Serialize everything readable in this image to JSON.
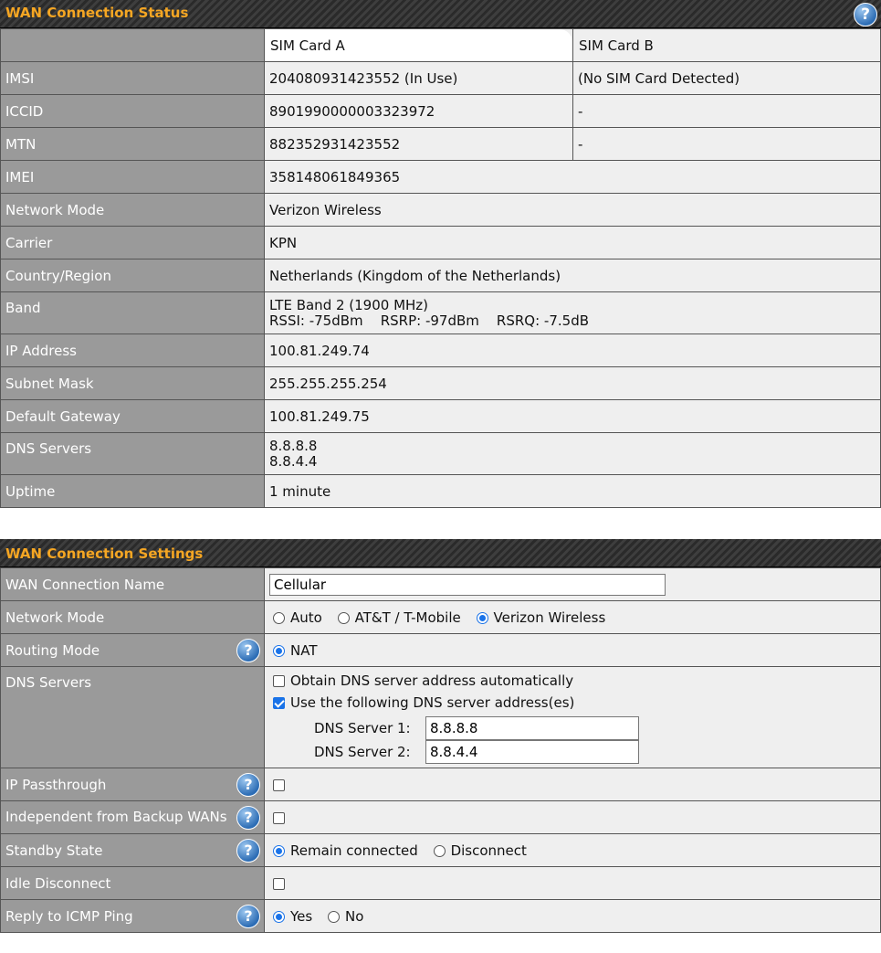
{
  "status": {
    "title": "WAN Connection Status",
    "columns": [
      "SIM Card A",
      "SIM Card B"
    ],
    "rows": [
      {
        "label": "IMSI",
        "a": "204080931423552 (In Use)",
        "b": "(No SIM Card Detected)"
      },
      {
        "label": "ICCID",
        "a": "8901990000003323972",
        "b": "-"
      },
      {
        "label": "MTN",
        "a": "882352931423552",
        "b": "-"
      },
      {
        "label": "IMEI",
        "value": "358148061849365"
      },
      {
        "label": "Network Mode",
        "value": "Verizon Wireless"
      },
      {
        "label": "Carrier",
        "value": "KPN"
      },
      {
        "label": "Country/Region",
        "value": "Netherlands (Kingdom of the Netherlands)"
      },
      {
        "label": "Band",
        "line1": "LTE Band 2 (1900 MHz)",
        "line2": "RSSI: -75dBm    RSRP: -97dBm    RSRQ: -7.5dB"
      },
      {
        "label": "IP Address",
        "value": "100.81.249.74"
      },
      {
        "label": "Subnet Mask",
        "value": "255.255.255.254"
      },
      {
        "label": "Default Gateway",
        "value": "100.81.249.75"
      },
      {
        "label": "DNS Servers",
        "line1": "8.8.8.8",
        "line2": "8.8.4.4"
      },
      {
        "label": "Uptime",
        "value": "1 minute"
      }
    ]
  },
  "settings": {
    "title": "WAN Connection Settings",
    "connection_name": {
      "label": "WAN Connection Name",
      "value": "Cellular"
    },
    "network_mode": {
      "label": "Network Mode",
      "options": [
        "Auto",
        "AT&T / T-Mobile",
        "Verizon Wireless"
      ],
      "selected": "Verizon Wireless"
    },
    "routing_mode": {
      "label": "Routing Mode",
      "options": [
        "NAT"
      ],
      "selected": "NAT"
    },
    "dns_servers": {
      "label": "DNS Servers",
      "auto_label": "Obtain DNS server address automatically",
      "auto_checked": false,
      "manual_label": "Use the following DNS server address(es)",
      "manual_checked": true,
      "server1_label": "DNS Server 1:",
      "server1_value": "8.8.8.8",
      "server2_label": "DNS Server 2:",
      "server2_value": "8.8.4.4"
    },
    "ip_passthrough": {
      "label": "IP Passthrough",
      "checked": false
    },
    "independent_backup": {
      "label": "Independent from Backup WANs",
      "checked": false
    },
    "standby_state": {
      "label": "Standby State",
      "options": [
        "Remain connected",
        "Disconnect"
      ],
      "selected": "Remain connected"
    },
    "idle_disconnect": {
      "label": "Idle Disconnect",
      "checked": false
    },
    "icmp_ping": {
      "label": "Reply to ICMP Ping",
      "options": [
        "Yes",
        "No"
      ],
      "selected": "Yes"
    }
  },
  "icons": {
    "help": "help-icon",
    "help_glyph": "?"
  }
}
